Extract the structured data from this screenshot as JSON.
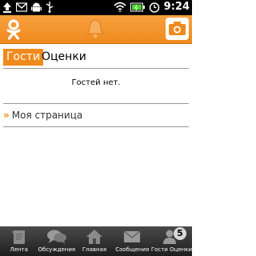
{
  "status_bar": {
    "time": "9:24",
    "icons": [
      "upload-icon",
      "gmail-icon",
      "android-icon",
      "usb-icon",
      "wifi-icon",
      "battery-icon",
      "alarm-icon"
    ]
  },
  "app_bar": {
    "accent": "#ef8a1c",
    "icons": [
      "odnoklassniki-logo",
      "notifications-bell-icon",
      "camera-icon"
    ]
  },
  "tabs": [
    {
      "label": "Гости",
      "active": true
    },
    {
      "label": "Оценки",
      "active": false
    }
  ],
  "content": {
    "empty_message": "Гостей нет.",
    "my_page_link": "Моя страница",
    "link_marker": "»"
  },
  "bottom_nav": {
    "items": [
      {
        "label": "Лента",
        "icon": "feed-icon"
      },
      {
        "label": "Обсуждения",
        "icon": "discussions-icon"
      },
      {
        "label": "Главная",
        "icon": "home-icon"
      },
      {
        "label": "Сообщения",
        "icon": "messages-icon"
      },
      {
        "label": "Гости Оценки",
        "icon": "guests-ratings-icon",
        "badge": "5"
      }
    ]
  }
}
